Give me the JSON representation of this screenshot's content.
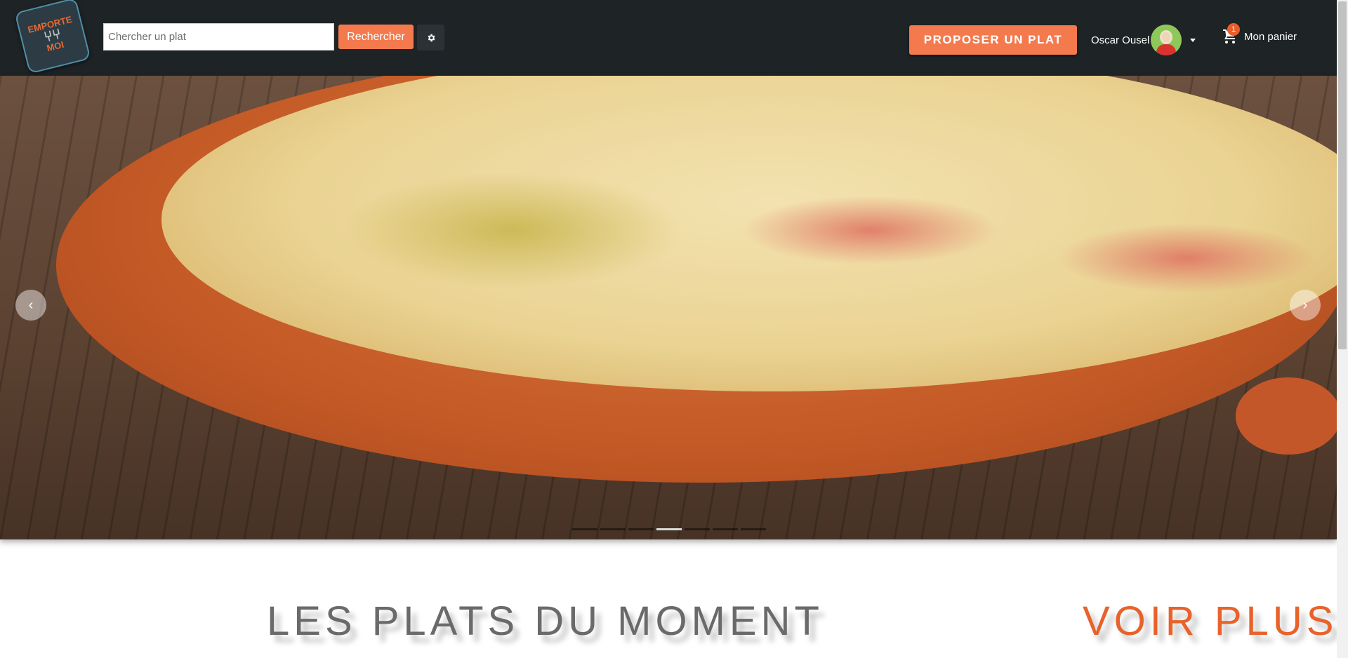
{
  "header": {
    "logo_text_top": "EMPORTE",
    "logo_text_bottom": "MOI",
    "search_placeholder": "Chercher un plat",
    "search_value": "",
    "search_button": "Rechercher",
    "settings_icon": "gear-icon",
    "propose_button": "PROPOSER UN PLAT",
    "user_name": "Oscar Ousel",
    "cart_label": "Mon panier",
    "cart_count": "1"
  },
  "carousel": {
    "prev_label": "‹",
    "next_label": "›",
    "slide_count": 7,
    "active_index": 3
  },
  "section": {
    "title": "LES PLATS DU MOMENT",
    "more_link": "VOIR PLUS"
  },
  "colors": {
    "navbar": "#1e2326",
    "accent": "#f47a4d",
    "section_title": "#6a6a6a",
    "more_link": "#e8622a"
  }
}
